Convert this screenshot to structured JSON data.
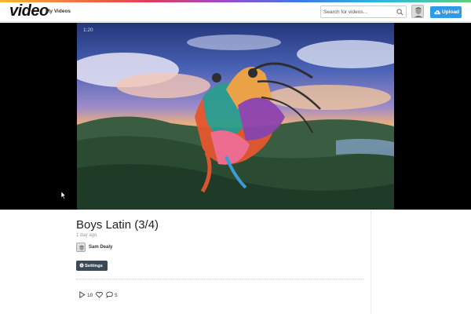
{
  "header": {
    "logo": "video",
    "nav_my_videos": "My Videos",
    "search_placeholder": "Search for videos...",
    "upload_label": "Upload",
    "accent_gradient": [
      "#f7b733",
      "#f06b42",
      "#e23b5a",
      "#9b4bd1",
      "#3b7be8",
      "#2bb7e0",
      "#5bd17a"
    ]
  },
  "player": {
    "timestamp": "1:20"
  },
  "video": {
    "title": "Boys Latin (3/4)",
    "posted": "1 day ago",
    "author": "Sam Dealy",
    "settings_label": "Settings",
    "plays": "10",
    "comments": "5"
  },
  "colors": {
    "upload_button": "#2f9be8",
    "settings_button": "#3c4a58"
  },
  "icons": [
    "search-icon",
    "upload-cloud-icon",
    "gear-icon",
    "play-icon",
    "heart-icon",
    "comment-icon",
    "pointer-cursor-icon"
  ]
}
